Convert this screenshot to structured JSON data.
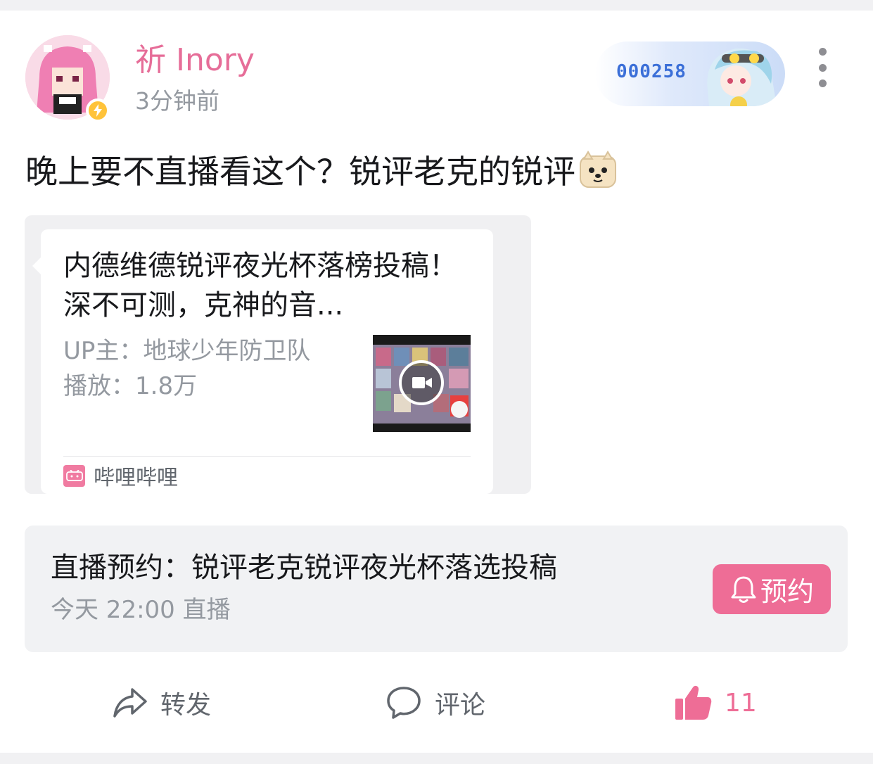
{
  "colors": {
    "accent_pink": "#ee6d96",
    "username_pink": "#e66d98",
    "badge_blue": "#3b6fd8",
    "muted_gray": "#9499a0",
    "text_dark": "#18191c"
  },
  "header": {
    "username": "祈 Inory",
    "time": "3分钟前",
    "fan_badge_number": "000258",
    "more_icon": "more-vertical-icon"
  },
  "post": {
    "text": "晚上要不直播看这个？锐评老克的锐评"
  },
  "shared_video": {
    "title": "内德维德锐评夜光杯落榜投稿！深不可测，克神的音...",
    "up": "UP主：地球少年防卫队",
    "plays": "播放：1.8万",
    "source": "哔哩哔哩",
    "source_icon": "bilibili-logo-icon",
    "thumb_icon": "video-camera-icon"
  },
  "live_reservation": {
    "title": "直播预约：锐评老克锐评夜光杯落选投稿",
    "time": "今天 22:00 直播",
    "button_label": "预约",
    "button_icon": "bell-icon"
  },
  "actions": {
    "forward_label": "转发",
    "comment_label": "评论",
    "like_count": "11"
  }
}
